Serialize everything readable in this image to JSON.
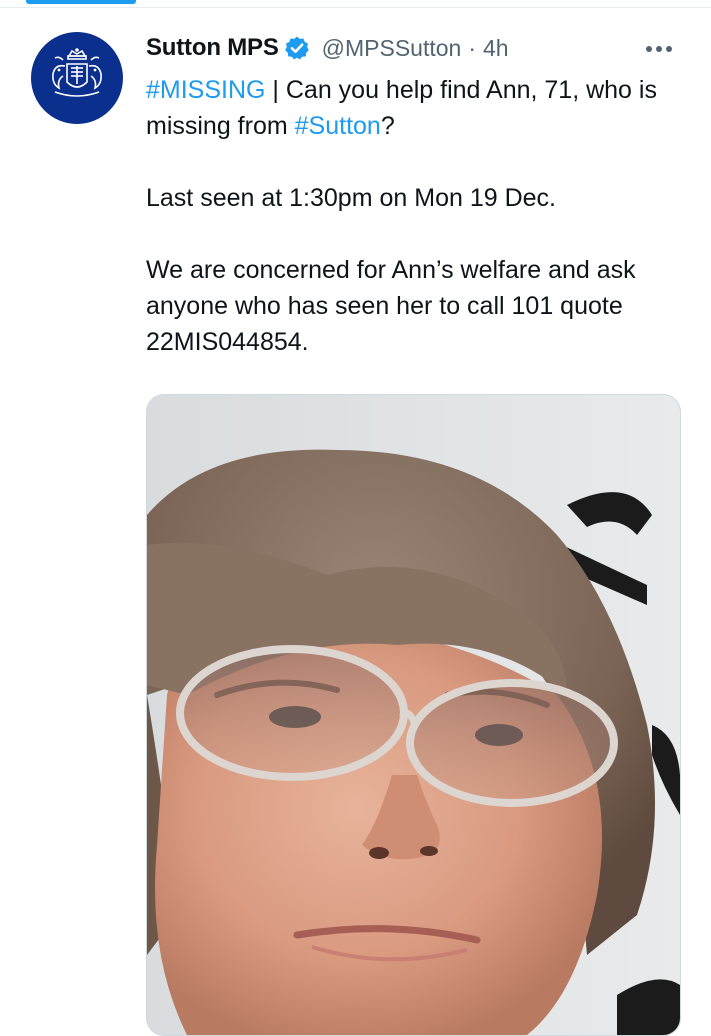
{
  "tweet": {
    "author_name": "Sutton MPS",
    "handle": "@MPSSutton",
    "separator": "·",
    "time": "4h",
    "hashtag_missing": "#MISSING",
    "text_1a": " | Can you help find Ann, 71, who is missing from ",
    "hashtag_sutton": "#Sutton",
    "text_1b": "?",
    "text_2": "Last seen at 1:30pm on Mon 19 Dec.",
    "text_3": "We are concerned for Ann’s welfare and ask anyone who has seen her to call 101 quote 22MIS044854."
  },
  "colors": {
    "accent": "#1d9bf0",
    "avatar_bg": "#0b2f8c",
    "muted": "#536471"
  },
  "icons": [
    "verified-badge-icon",
    "more-options-icon",
    "police-crest-icon"
  ]
}
